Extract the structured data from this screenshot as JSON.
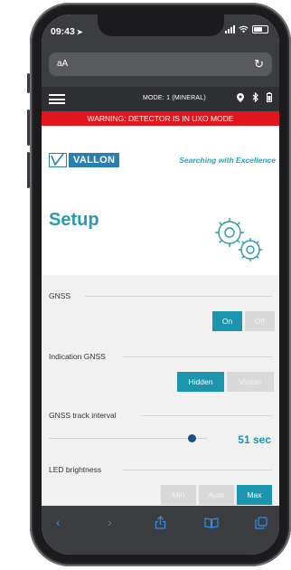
{
  "status_bar": {
    "time": "09:43",
    "location_arrow": "location-arrow-icon"
  },
  "browser": {
    "text_size_button": "aA",
    "reload_icon": "reload-icon"
  },
  "app_header": {
    "mode": "MODE: 1 (MINERAL)"
  },
  "warning": {
    "text": "WARNING: DETECTOR IS IN UXO MODE"
  },
  "brand": {
    "logo_text": "VALLON",
    "tagline": "Searching with Excellence"
  },
  "page": {
    "title": "Setup"
  },
  "settings": {
    "gnss": {
      "label": "GNSS",
      "options": [
        "On",
        "Off"
      ],
      "selected": "On"
    },
    "indication_gnss": {
      "label": "Indication GNSS",
      "options": [
        "Hidden",
        "Visible"
      ],
      "selected": "Hidden"
    },
    "gnss_track_interval": {
      "label": "GNSS track interval",
      "value": "51 sec"
    },
    "led_brightness": {
      "label": "LED brightness",
      "options": [
        "Min",
        "Auto",
        "Max"
      ],
      "selected": "Max"
    }
  },
  "colors": {
    "accent": "#1b95ad",
    "warning": "#e1151b",
    "brand": "#2a7fb0",
    "slider_thumb": "#1c4f8a"
  }
}
